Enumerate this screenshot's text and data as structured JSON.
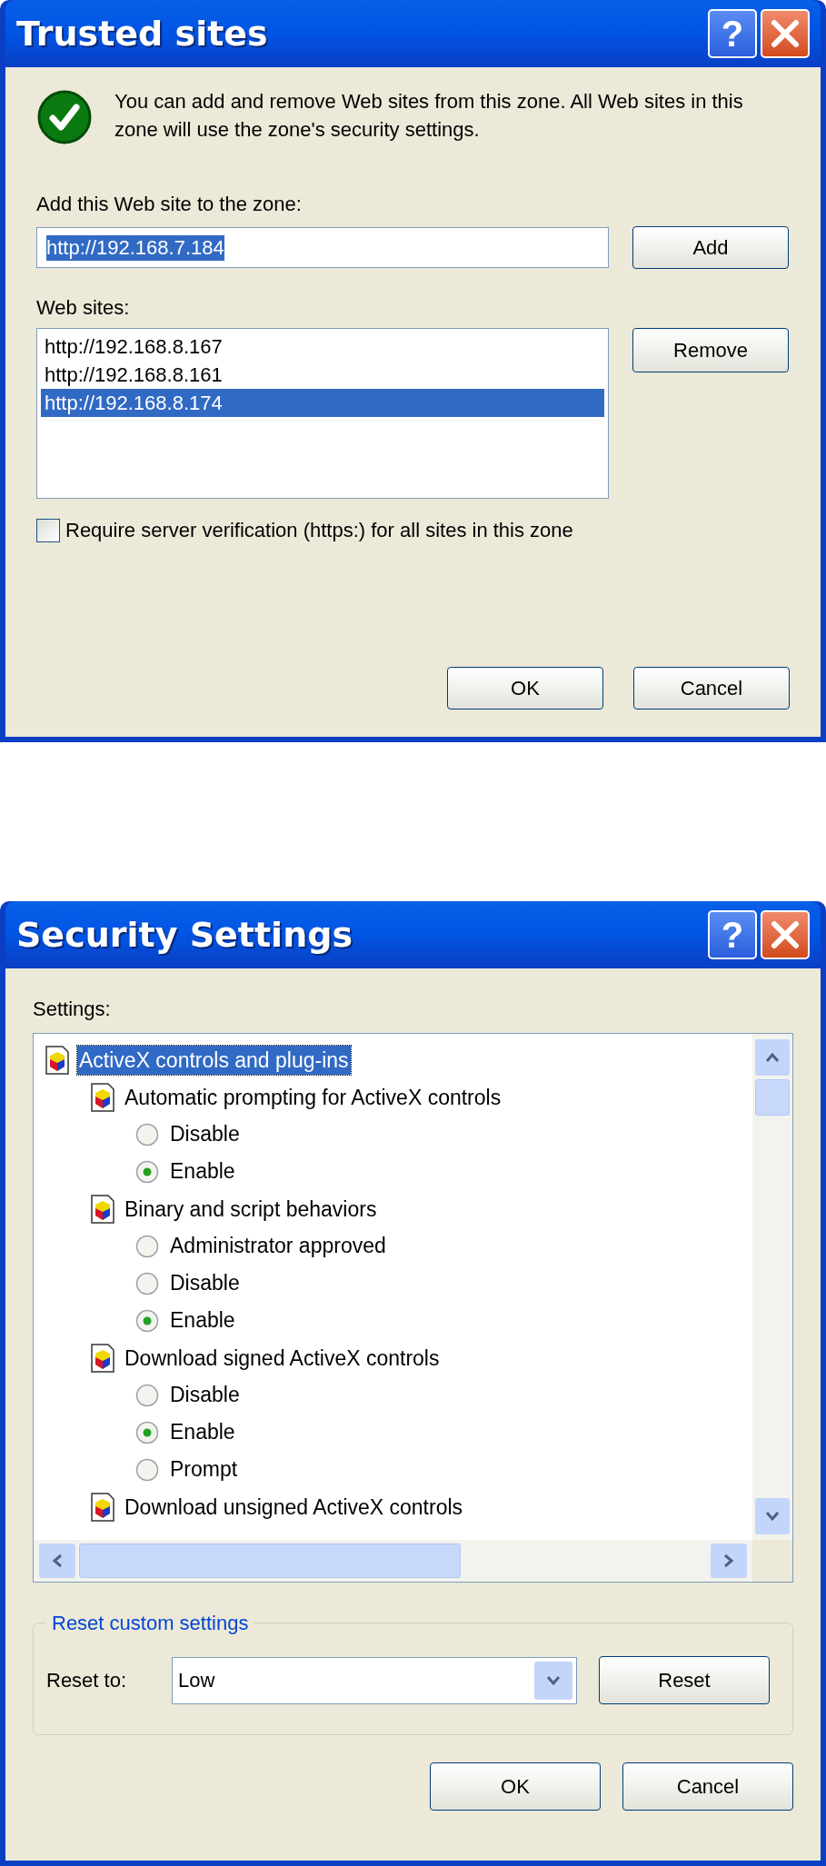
{
  "trusted_sites": {
    "title": "Trusted sites",
    "help_button": "?",
    "info_text": "You can add and remove Web sites from this zone. All Web sites in this zone will use the zone's security settings.",
    "add_label": "Add this Web site to the zone:",
    "add_value": "http://192.168.7.184",
    "add_button": "Add",
    "sites_label": "Web sites:",
    "sites": [
      {
        "label": "http://192.168.8.167",
        "selected": false
      },
      {
        "label": "http://192.168.8.161",
        "selected": false
      },
      {
        "label": "http://192.168.8.174",
        "selected": true
      }
    ],
    "remove_button": "Remove",
    "require_https": {
      "label": "Require server verification (https:) for all sites in this zone",
      "checked": false
    },
    "buttons": [
      "OK",
      "Cancel"
    ]
  },
  "security_settings": {
    "title": "Security Settings",
    "help_button": "?",
    "settings_label": "Settings:",
    "tree": [
      {
        "label": "ActiveX controls and plug-ins",
        "selected": true,
        "children": [
          {
            "label": "Automatic prompting for ActiveX controls",
            "selected": false,
            "options": [
              {
                "label": "Disable",
                "checked": false
              },
              {
                "label": "Enable",
                "checked": true
              }
            ]
          },
          {
            "label": "Binary and script behaviors",
            "selected": false,
            "options": [
              {
                "label": "Administrator approved",
                "checked": false
              },
              {
                "label": "Disable",
                "checked": false
              },
              {
                "label": "Enable",
                "checked": true
              }
            ]
          },
          {
            "label": "Download signed ActiveX controls",
            "selected": false,
            "options": [
              {
                "label": "Disable",
                "checked": false
              },
              {
                "label": "Enable",
                "checked": true
              },
              {
                "label": "Prompt",
                "checked": false
              }
            ]
          },
          {
            "label": "Download unsigned ActiveX controls",
            "selected": false
          }
        ]
      }
    ],
    "reset_group": {
      "legend": "Reset custom settings",
      "label": "Reset to:",
      "value": "Low",
      "button": "Reset"
    },
    "buttons": [
      "OK",
      "Cancel"
    ]
  }
}
